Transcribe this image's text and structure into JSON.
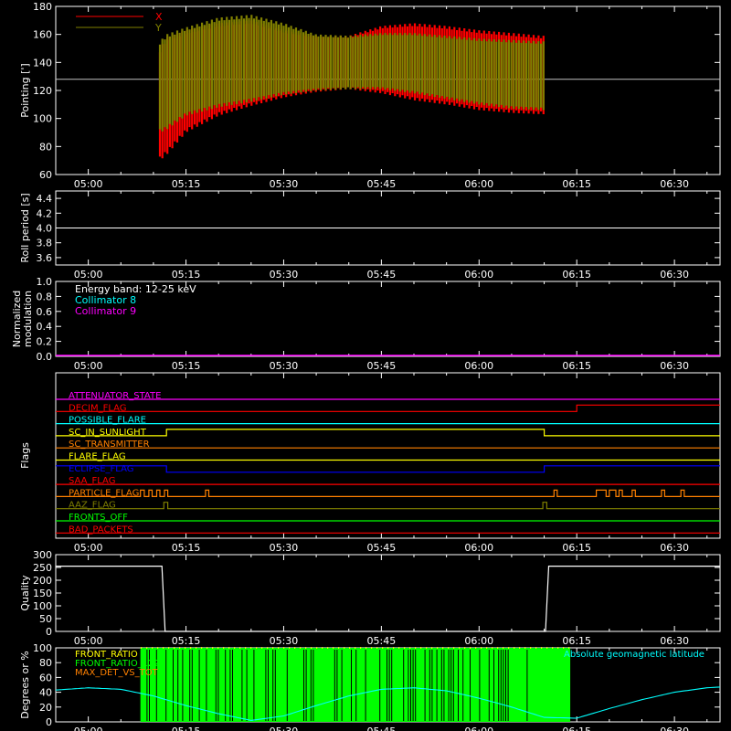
{
  "figure": {
    "time_ticks": [
      "05:00",
      "05:15",
      "05:30",
      "05:45",
      "06:00",
      "06:15",
      "06:30"
    ],
    "colors": {
      "background": "#000000",
      "axes": "#ffffff"
    }
  },
  "chart_data": [
    {
      "id": "pointing",
      "type": "area",
      "ylabel": "Pointing [']",
      "ylim": [
        60,
        180
      ],
      "yticks": [
        60,
        80,
        100,
        120,
        140,
        160,
        180
      ],
      "reference_line": 128,
      "legend": [
        "X",
        "Y"
      ],
      "series": [
        {
          "name": "X",
          "color": "#ff0000",
          "t": [
            "05:11",
            "05:12",
            "05:15",
            "05:20",
            "05:25",
            "05:30",
            "05:35",
            "05:40",
            "05:45",
            "05:50",
            "05:55",
            "06:00",
            "06:05",
            "06:10"
          ],
          "max": [
            150,
            158,
            163,
            168,
            170,
            163,
            159,
            159,
            166,
            168,
            166,
            163,
            161,
            159
          ],
          "min": [
            70,
            74,
            90,
            102,
            109,
            115,
            119,
            121,
            118,
            113,
            110,
            106,
            104,
            103
          ]
        },
        {
          "name": "Y",
          "color": "#808000",
          "t": [
            "05:11",
            "05:12",
            "05:15",
            "05:20",
            "05:25",
            "05:30",
            "05:35",
            "05:40",
            "05:45",
            "05:50",
            "05:55",
            "06:00",
            "06:05",
            "06:10"
          ],
          "max": [
            155,
            160,
            165,
            172,
            174,
            168,
            160,
            159,
            161,
            161,
            159,
            157,
            156,
            155
          ],
          "min": [
            90,
            92,
            102,
            108,
            112,
            117,
            120,
            121,
            121,
            118,
            114,
            110,
            107,
            106
          ]
        }
      ]
    },
    {
      "id": "roll",
      "type": "line",
      "ylabel": "Roll period [s]",
      "ylim": [
        3.5,
        4.5
      ],
      "yticks": [
        3.6,
        3.8,
        4.0,
        4.2,
        4.4
      ],
      "series": [
        {
          "name": "",
          "color": "#ffffff",
          "t": [
            "04:55",
            "06:37"
          ],
          "y": [
            4.0,
            4.0
          ]
        }
      ]
    },
    {
      "id": "modulation",
      "type": "line",
      "ylabel": [
        "Normalized",
        "modulation"
      ],
      "ylim": [
        0,
        1
      ],
      "yticks": [
        0.0,
        0.2,
        0.4,
        0.6,
        0.8,
        1.0
      ],
      "legend": [
        {
          "text": "Energy band: 12-25 keV",
          "color": "#ffffff"
        },
        {
          "text": "Collimator 8",
          "color": "#00ffff"
        },
        {
          "text": "Collimator 9",
          "color": "#ff00ff"
        }
      ],
      "series": [
        {
          "name": "",
          "color": "#ff00ff",
          "t": [
            "04:55",
            "06:37"
          ],
          "y": [
            0.0,
            0.0
          ]
        }
      ]
    },
    {
      "id": "flags",
      "type": "line",
      "ylabel": "Flags",
      "flags": [
        {
          "label": "ATTENUATOR_STATE",
          "color": "#ff00ff",
          "t": [
            "04:55",
            "06:37"
          ],
          "s": [
            0,
            0
          ]
        },
        {
          "label": "DECIM_FLAG",
          "color": "#ff0000",
          "t": [
            "04:55",
            "06:15",
            "06:37"
          ],
          "s": [
            0,
            1,
            1
          ]
        },
        {
          "label": "POSSIBLE_FLARE",
          "color": "#00ffff",
          "t": [
            "04:55",
            "06:37"
          ],
          "s": [
            0,
            0
          ]
        },
        {
          "label": "SC_IN_SUNLIGHT",
          "color": "#ffff00",
          "t": [
            "04:55",
            "05:12",
            "06:10",
            "06:37"
          ],
          "s": [
            0,
            1,
            0,
            0
          ]
        },
        {
          "label": "SC_TRANSMITTER",
          "color": "#ff8000",
          "t": [
            "04:55",
            "06:37"
          ],
          "s": [
            0,
            0
          ]
        },
        {
          "label": "FLARE_FLAG",
          "color": "#ffff00",
          "t": [
            "04:55",
            "06:37"
          ],
          "s": [
            0,
            0
          ]
        },
        {
          "label": "ECLIPSE_FLAG",
          "color": "#0000ff",
          "t": [
            "04:55",
            "05:12",
            "06:10",
            "06:37"
          ],
          "s": [
            1,
            0,
            1,
            1
          ]
        },
        {
          "label": "SAA_FLAG",
          "color": "#ff0000",
          "t": [
            "04:55",
            "06:37"
          ],
          "s": [
            0,
            0
          ]
        },
        {
          "label": "PARTICLE_FLAG",
          "color": "#ff8000",
          "t": [
            "04:55",
            "05:08",
            "05:08.6",
            "05:09.3",
            "05:09.8",
            "05:10.5",
            "05:11",
            "05:11.7",
            "05:12.2",
            "05:18",
            "05:18.5",
            "06:11.5",
            "06:12",
            "06:18",
            "06:19.5",
            "06:20",
            "06:21",
            "06:21.5",
            "06:22",
            "06:23.5",
            "06:24",
            "06:28",
            "06:28.5",
            "06:31",
            "06:31.5",
            "06:37"
          ],
          "s": [
            0,
            1,
            0,
            1,
            0,
            1,
            0,
            1,
            0,
            1,
            0,
            1,
            0,
            1,
            0,
            1,
            0,
            1,
            0,
            1,
            0,
            1,
            0,
            1,
            0,
            0
          ]
        },
        {
          "label": "AAZ_FLAG",
          "color": "#808000",
          "t": [
            "04:55",
            "05:11.6",
            "05:12.2",
            "06:09.8",
            "06:10.4",
            "06:37"
          ],
          "s": [
            0,
            1,
            0,
            1,
            0,
            0
          ]
        },
        {
          "label": "FRONTS_OFF",
          "color": "#00ff00",
          "t": [
            "04:55",
            "06:37"
          ],
          "s": [
            0,
            0
          ]
        },
        {
          "label": "BAD_PACKETS",
          "color": "#ff0000",
          "t": [
            "04:55",
            "06:37"
          ],
          "s": [
            0,
            0
          ]
        }
      ]
    },
    {
      "id": "quality",
      "type": "line",
      "ylabel": "Quality",
      "ylim": [
        0,
        300
      ],
      "yticks": [
        0,
        50,
        100,
        150,
        200,
        250,
        300
      ],
      "series": [
        {
          "name": "",
          "color": "#ffffff",
          "t": [
            "04:55",
            "05:11.3",
            "05:11.8",
            "06:10.2",
            "06:10.7",
            "06:37"
          ],
          "y": [
            255,
            255,
            0,
            0,
            255,
            255
          ]
        }
      ]
    },
    {
      "id": "ratios",
      "type": "line",
      "ylabel": "Degrees or %",
      "ylim": [
        0,
        100
      ],
      "yticks": [
        0,
        20,
        40,
        60,
        80,
        100
      ],
      "legend": [
        {
          "text": "FRONT_RATIO",
          "color": "#ffff00"
        },
        {
          "text": "FRONT_RATIO_1225",
          "color": "#00ff00"
        },
        {
          "text": "MAX_DET_VS_TOT",
          "color": "#ff8000"
        },
        {
          "text": "Absolute geomagnetic latitude",
          "color": "#00ffff"
        }
      ],
      "front_ratio_1225": {
        "name": "FRONT_RATIO_1225",
        "color": "#00ff00",
        "t_range": [
          "05:08",
          "06:14"
        ],
        "y": 100
      },
      "series": [
        {
          "name": "Absolute geomagnetic latitude",
          "color": "#00ffff",
          "t": [
            "04:55",
            "05:00",
            "05:05",
            "05:10",
            "05:15",
            "05:20",
            "05:25",
            "05:30",
            "05:35",
            "05:40",
            "05:45",
            "05:50",
            "05:55",
            "06:00",
            "06:05",
            "06:10",
            "06:15",
            "06:20",
            "06:25",
            "06:30",
            "06:35",
            "06:37"
          ],
          "y": [
            43,
            46,
            44,
            35,
            22,
            11,
            2,
            8,
            22,
            35,
            44,
            46,
            42,
            32,
            20,
            6,
            5,
            18,
            30,
            40,
            46,
            47
          ]
        }
      ]
    }
  ]
}
